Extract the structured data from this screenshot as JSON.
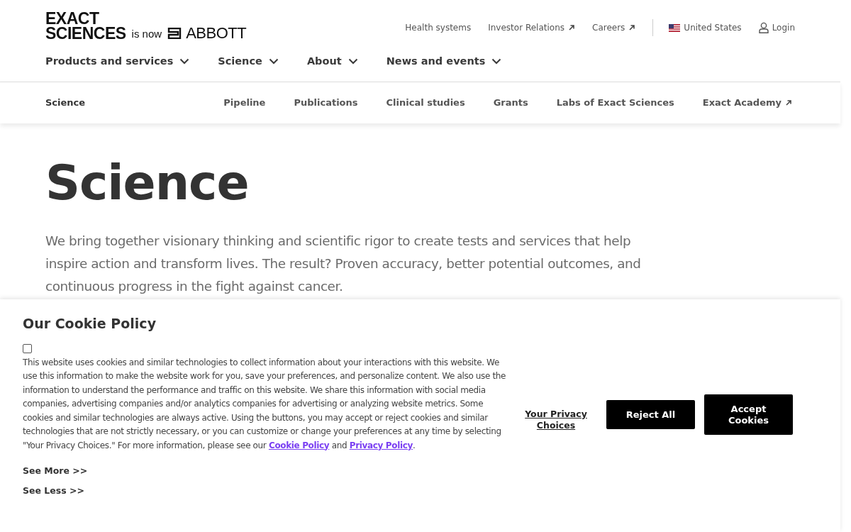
{
  "logo": {
    "line_1": "EXACT",
    "line_2": "SCIENCES",
    "connector": "is now",
    "partner": "ABBOTT"
  },
  "utility_nav": [
    {
      "label": "Health systems",
      "external": false
    },
    {
      "label": "Investor Relations",
      "external": true
    },
    {
      "label": "Careers",
      "external": true
    }
  ],
  "region": {
    "label": "United States"
  },
  "login": {
    "label": "Login"
  },
  "main_nav": [
    {
      "label": "Products and services"
    },
    {
      "label": "Science"
    },
    {
      "label": "About"
    },
    {
      "label": "News and events"
    }
  ],
  "sub_nav": {
    "section": "Science",
    "items": [
      {
        "label": "Pipeline",
        "external": false
      },
      {
        "label": "Publications",
        "external": false
      },
      {
        "label": "Clinical studies",
        "external": false
      },
      {
        "label": "Grants",
        "external": false
      },
      {
        "label": "Labs of Exact Sciences",
        "external": false
      },
      {
        "label": "Exact Academy",
        "external": true
      }
    ]
  },
  "hero": {
    "title": "Science",
    "intro": "We bring together visionary thinking and scientific rigor to create tests and services that help inspire action and transform lives. The result? Proven accuracy, better potential outcomes, and continuous progress in the fight against cancer."
  },
  "cookie_banner": {
    "title": "Our Cookie Policy",
    "checked": false,
    "text": "This website uses cookies and similar technologies to collect information about your interactions with this website. We use this information to make the website work for you, save your preferences, and personalize content. We also use the information to understand the performance and traffic on this website. We share this information with social media companies, advertising companies and/or analytics companies for advertising or analyzing website metrics. Some cookies and similar technologies are always active. Using the buttons, you may accept or reject cookies and similar technologies that are not strictly necessary, or you can customize or change your preferences at any time by selecting \"Your Privacy Choices.\" For more information, please see our",
    "links": [
      "Cookie Policy",
      "Privacy Policy"
    ],
    "joiner": "and",
    "end": ".",
    "see_more": "See More >>",
    "see_less": "See Less >>",
    "privacy_choices": "Your Privacy Choices",
    "reject": "Reject All",
    "accept": "Accept Cookies"
  }
}
